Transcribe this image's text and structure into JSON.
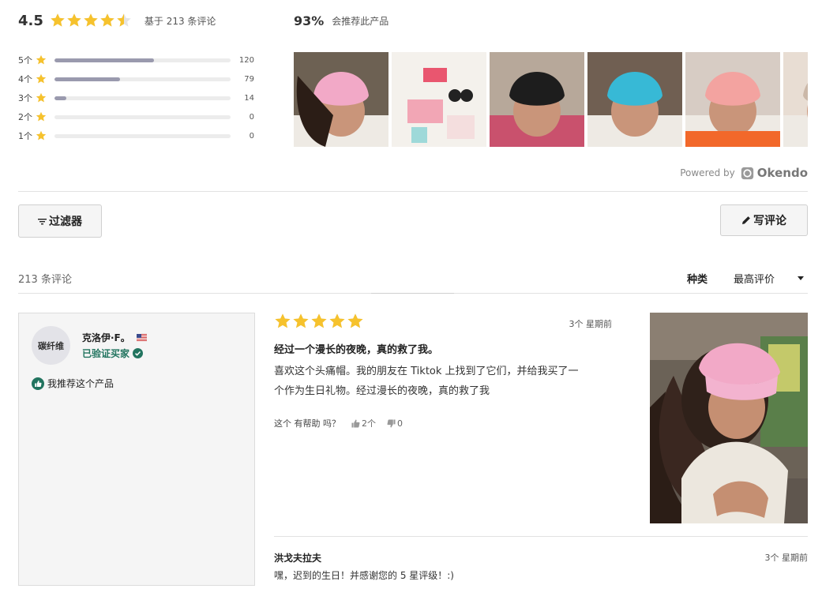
{
  "summary": {
    "average": "4.5",
    "average_value": 4.5,
    "based_on": "基于 213 条评论",
    "recommend_pct": "93%",
    "recommend_text": "会推荐此产品",
    "star_color": "#f6c22d"
  },
  "distribution": [
    {
      "label": "5个",
      "count": "120",
      "fraction": 0.565
    },
    {
      "label": "4个",
      "count": "79",
      "fraction": 0.372
    },
    {
      "label": "3个",
      "count": "14",
      "fraction": 0.066
    },
    {
      "label": "2个",
      "count": "0",
      "fraction": 0
    },
    {
      "label": "1个",
      "count": "0",
      "fraction": 0
    }
  ],
  "gallery": [
    {
      "name": "photo-pink-cap-woman",
      "color": "#f2a9c7"
    },
    {
      "name": "photo-products-flatlay",
      "color": "#e9566f"
    },
    {
      "name": "photo-black-cap-man",
      "color": "#1d1d1d"
    },
    {
      "name": "photo-blue-cap-woman",
      "color": "#37b9d6"
    },
    {
      "name": "photo-pink-cap-pillow",
      "color": "#f3a3a0"
    },
    {
      "name": "photo-partial",
      "color": "#cbb8a8"
    }
  ],
  "powered": {
    "prefix": "Powered by",
    "brand": "Okendo"
  },
  "toolbar": {
    "filter_label": "过滤器",
    "write_label": "写评论",
    "review_count": "213 条评论",
    "sort_label": "种类",
    "sort_value": "最高评价"
  },
  "review": {
    "reviewer_initials": "碳纤维",
    "reviewer_name": "克洛伊·F。",
    "verified_label": "已验证买家",
    "recommend_label": "我推荐这个产品",
    "rating": 5,
    "date": "3个 星期前",
    "title": "经过一个漫长的夜晚，真的救了我。",
    "body_line1": "喜欢这个头痛帽。我的朋友在 Tiktok 上找到了它们，并给我买了一",
    "body_line2": "个作为生日礼物。经过漫长的夜晚，真的救了我",
    "helpful_label": "这个 有帮助 吗？",
    "up_votes": "2个",
    "down_votes": "0"
  },
  "reply": {
    "name": "洪戈夫拉夫",
    "date": "3个 星期前",
    "body": "嘿，迟到的生日！并感谢您的 5 星评级！:)"
  }
}
